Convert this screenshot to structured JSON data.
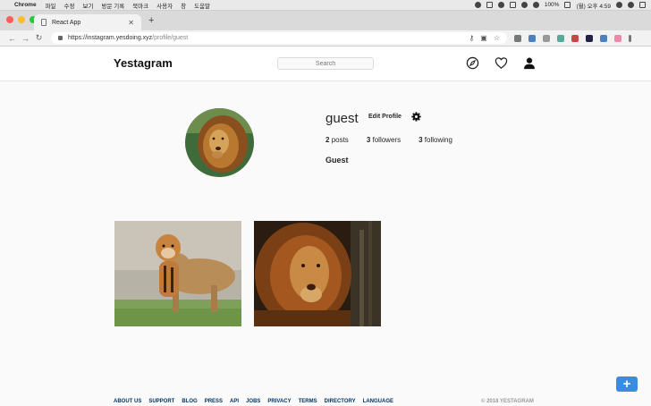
{
  "menubar": {
    "app": "Chrome",
    "items": [
      "파일",
      "수정",
      "보기",
      "방문 기록",
      "북마크",
      "사용자",
      "창",
      "도움말"
    ],
    "battery": "100%",
    "clock": "(월) 오후 4:59"
  },
  "browser": {
    "tab_title": "React App",
    "url_host": "https://instagram.yesdoing.xyz",
    "url_path": "/profile/guest"
  },
  "header": {
    "logo": "Yestagram",
    "search_placeholder": "Search"
  },
  "profile": {
    "username": "guest",
    "edit_label": "Edit Profile",
    "posts_count": "2",
    "posts_label": "posts",
    "followers_count": "3",
    "followers_label": "followers",
    "following_count": "3",
    "following_label": "following",
    "full_name": "Guest"
  },
  "footer": {
    "links": [
      "ABOUT US",
      "SUPPORT",
      "BLOG",
      "PRESS",
      "API",
      "JOBS",
      "PRIVACY",
      "TERMS",
      "DIRECTORY",
      "LANGUAGE"
    ],
    "copyright": "© 2018 YESTAGRAM"
  },
  "fab_label": "+",
  "colors": {
    "accent": "#3b8be0",
    "link": "#003569"
  }
}
